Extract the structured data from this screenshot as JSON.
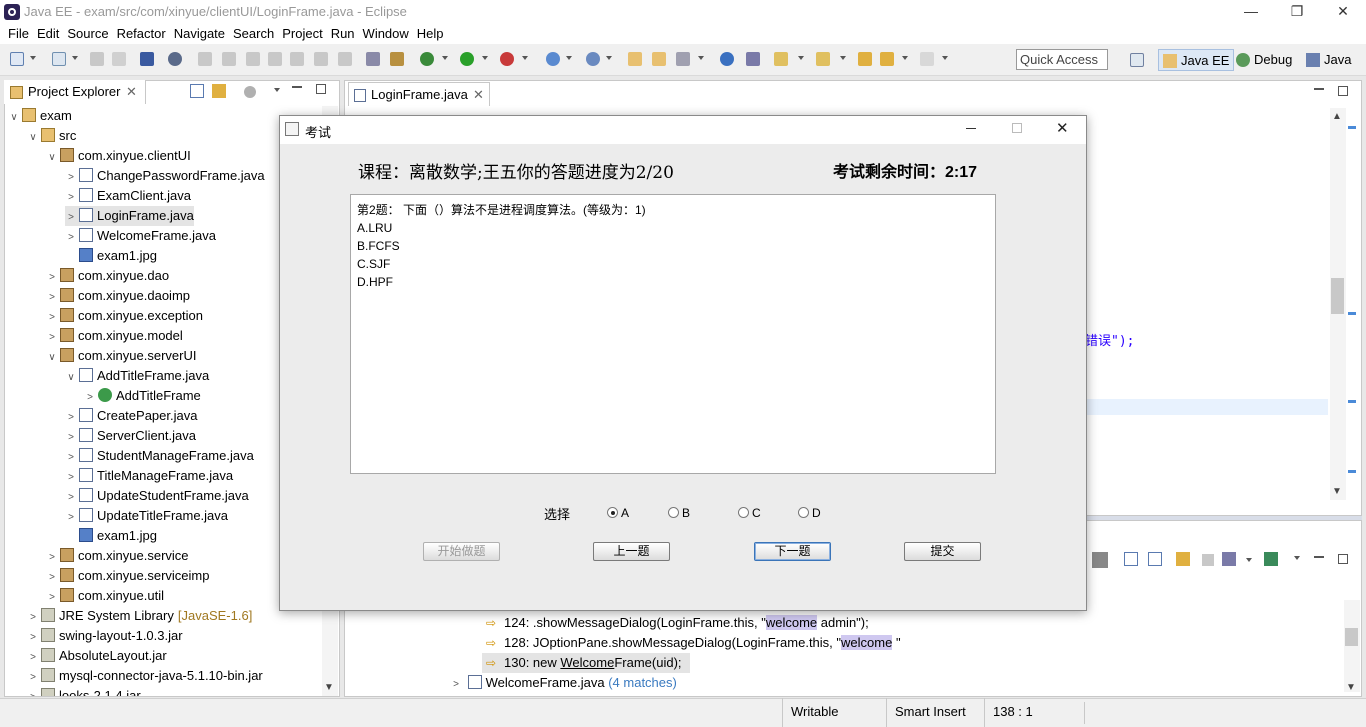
{
  "window": {
    "title": "Java EE - exam/src/com/xinyue/clientUI/LoginFrame.java - Eclipse",
    "minimize": "—",
    "maximize": "❐",
    "close": "✕"
  },
  "menu": [
    "File",
    "Edit",
    "Source",
    "Refactor",
    "Navigate",
    "Search",
    "Project",
    "Run",
    "Window",
    "Help"
  ],
  "toolbar": {
    "quick_access": "Quick Access",
    "perspectives": [
      "Java EE",
      "Debug",
      "Java"
    ]
  },
  "project_explorer": {
    "tab_label": "Project Explorer",
    "tree": [
      {
        "label": "exam",
        "type": "project",
        "depth": 0,
        "twisty": "open"
      },
      {
        "label": "src",
        "type": "folder",
        "depth": 1,
        "twisty": "open"
      },
      {
        "label": "com.xinyue.clientUI",
        "type": "package",
        "depth": 2,
        "twisty": "open"
      },
      {
        "label": "ChangePasswordFrame.java",
        "type": "java",
        "depth": 3,
        "twisty": "closed"
      },
      {
        "label": "ExamClient.java",
        "type": "java",
        "depth": 3,
        "twisty": "closed"
      },
      {
        "label": "LoginFrame.java",
        "type": "java",
        "depth": 3,
        "twisty": "closed",
        "selected": true
      },
      {
        "label": "WelcomeFrame.java",
        "type": "java",
        "depth": 3,
        "twisty": "closed"
      },
      {
        "label": "exam1.jpg",
        "type": "image",
        "depth": 3,
        "twisty": "none"
      },
      {
        "label": "com.xinyue.dao",
        "type": "package",
        "depth": 2,
        "twisty": "closed"
      },
      {
        "label": "com.xinyue.daoimp",
        "type": "package",
        "depth": 2,
        "twisty": "closed"
      },
      {
        "label": "com.xinyue.exception",
        "type": "package",
        "depth": 2,
        "twisty": "closed"
      },
      {
        "label": "com.xinyue.model",
        "type": "package",
        "depth": 2,
        "twisty": "closed"
      },
      {
        "label": "com.xinyue.serverUI",
        "type": "package",
        "depth": 2,
        "twisty": "open"
      },
      {
        "label": "AddTitleFrame.java",
        "type": "java",
        "depth": 3,
        "twisty": "open"
      },
      {
        "label": "AddTitleFrame",
        "type": "class",
        "depth": 4,
        "twisty": "closed"
      },
      {
        "label": "CreatePaper.java",
        "type": "java",
        "depth": 3,
        "twisty": "closed"
      },
      {
        "label": "ServerClient.java",
        "type": "java",
        "depth": 3,
        "twisty": "closed"
      },
      {
        "label": "StudentManageFrame.java",
        "type": "java",
        "depth": 3,
        "twisty": "closed"
      },
      {
        "label": "TitleManageFrame.java",
        "type": "java",
        "depth": 3,
        "twisty": "closed"
      },
      {
        "label": "UpdateStudentFrame.java",
        "type": "java",
        "depth": 3,
        "twisty": "closed"
      },
      {
        "label": "UpdateTitleFrame.java",
        "type": "java",
        "depth": 3,
        "twisty": "closed"
      },
      {
        "label": "exam1.jpg",
        "type": "image",
        "depth": 3,
        "twisty": "none"
      },
      {
        "label": "com.xinyue.service",
        "type": "package",
        "depth": 2,
        "twisty": "closed"
      },
      {
        "label": "com.xinyue.serviceimp",
        "type": "package",
        "depth": 2,
        "twisty": "closed"
      },
      {
        "label": "com.xinyue.util",
        "type": "package",
        "depth": 2,
        "twisty": "closed"
      },
      {
        "label": "JRE System Library",
        "suffix": "[JavaSE-1.6]",
        "type": "library",
        "depth": 1,
        "twisty": "closed"
      },
      {
        "label": "swing-layout-1.0.3.jar",
        "type": "jar",
        "depth": 1,
        "twisty": "closed"
      },
      {
        "label": "AbsoluteLayout.jar",
        "type": "jar",
        "depth": 1,
        "twisty": "closed"
      },
      {
        "label": "mysql-connector-java-5.1.10-bin.jar",
        "type": "jar",
        "depth": 1,
        "twisty": "closed"
      },
      {
        "label": "looks-2.1.4.jar",
        "type": "jar",
        "depth": 1,
        "twisty": "closed"
      }
    ]
  },
  "editor": {
    "tab_label": "LoginFrame.java",
    "visible_code_fragment": "错误\");"
  },
  "search_results": {
    "rows": [
      {
        "pre": "124: .showMessageDialog(LoginFrame.this, \"",
        "match": "welcome",
        "post": " admin\");"
      },
      {
        "pre": "128: JOptionPane.showMessageDialog(LoginFrame.this, \"",
        "match": "welcome",
        "post": " \""
      },
      {
        "pre": "130: new ",
        "match": "Welcome",
        "post": "Frame(uid);"
      }
    ],
    "file_label": "WelcomeFrame.java",
    "file_matches": "(4 matches)"
  },
  "status": {
    "writable": "Writable",
    "insert_mode": "Smart Insert",
    "position": "138 : 1"
  },
  "dialog": {
    "title": "考试",
    "course_line": "课程：离散数学;王五你的答题进度为2/20",
    "timer_line": "考试剩余时间：2:17",
    "question_lines": [
      "第2题：  下面（）算法不是进程调度算法。(等级为：1)",
      "A.LRU",
      "B.FCFS",
      "C.SJF",
      "D.HPF"
    ],
    "choice_label": "选择",
    "options": [
      "A",
      "B",
      "C",
      "D"
    ],
    "selected_option": "A",
    "buttons": {
      "start": "开始做题",
      "prev": "上一题",
      "next": "下一题",
      "submit": "提交"
    }
  }
}
